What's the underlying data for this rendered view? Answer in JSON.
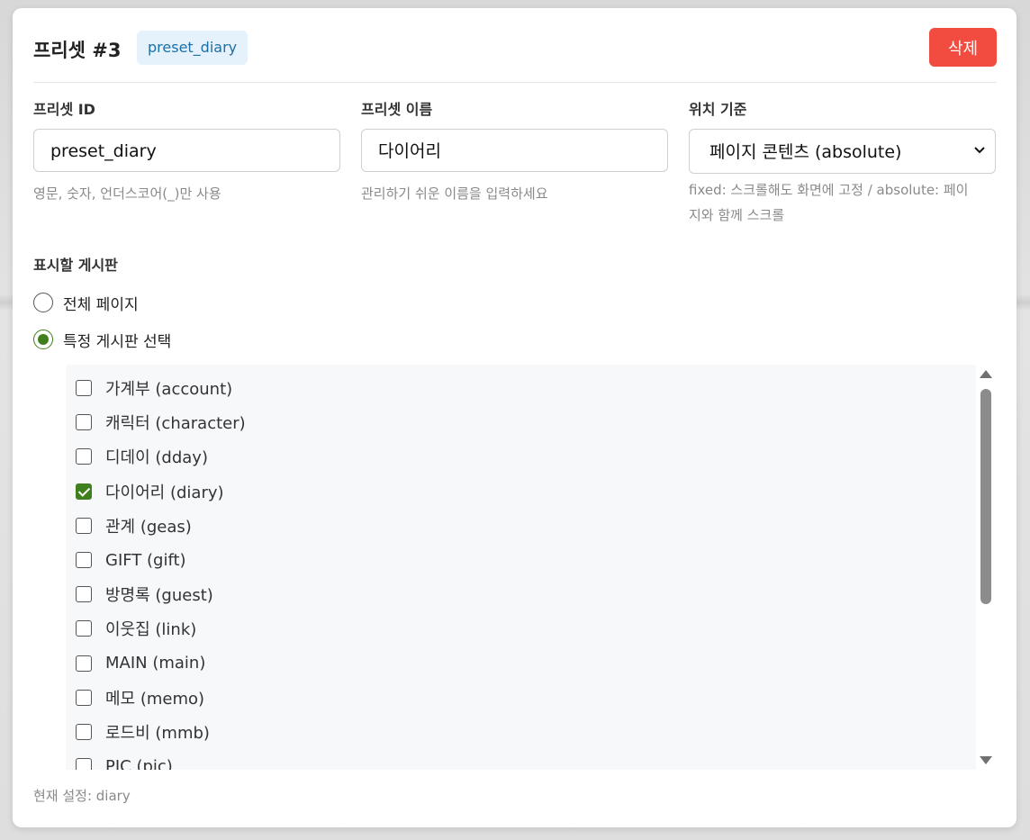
{
  "preset": {
    "title": "프리셋 #3",
    "badge": "preset_diary",
    "delete_label": "삭제"
  },
  "fields": {
    "id": {
      "label": "프리셋 ID",
      "value": "preset_diary",
      "help": "영문, 숫자, 언더스코어(_)만 사용"
    },
    "name": {
      "label": "프리셋 이름",
      "value": "다이어리",
      "help": "관리하기 쉬운 이름을 입력하세요"
    },
    "position": {
      "label": "위치 기준",
      "selected": "페이지 콘텐츠 (absolute)",
      "help_line1": "fixed: 스크롤해도 화면에 고정 / absolute: 페이",
      "help_line2": "지와 함께 스크롤"
    }
  },
  "boards_section": {
    "label": "표시할 게시판",
    "radio_all": "전체 페이지",
    "radio_specific": "특정 게시판 선택",
    "selected_radio": "specific"
  },
  "boards": [
    {
      "label": "가계부 (account)",
      "checked": false
    },
    {
      "label": "캐릭터 (character)",
      "checked": false
    },
    {
      "label": "디데이 (dday)",
      "checked": false
    },
    {
      "label": "다이어리 (diary)",
      "checked": true
    },
    {
      "label": "관계 (geas)",
      "checked": false
    },
    {
      "label": "GIFT (gift)",
      "checked": false
    },
    {
      "label": "방명록 (guest)",
      "checked": false
    },
    {
      "label": "이웃집 (link)",
      "checked": false
    },
    {
      "label": "MAIN (main)",
      "checked": false
    },
    {
      "label": "메모 (memo)",
      "checked": false
    },
    {
      "label": "로드비 (mmb)",
      "checked": false
    },
    {
      "label": "PIC (pic)",
      "checked": false
    }
  ],
  "current_setting": "현재 설정: diary",
  "colors": {
    "accent": "#3f7f1e",
    "danger": "#f24b3f",
    "badge_bg": "#e5f1fb",
    "badge_text": "#1d6fa5"
  }
}
